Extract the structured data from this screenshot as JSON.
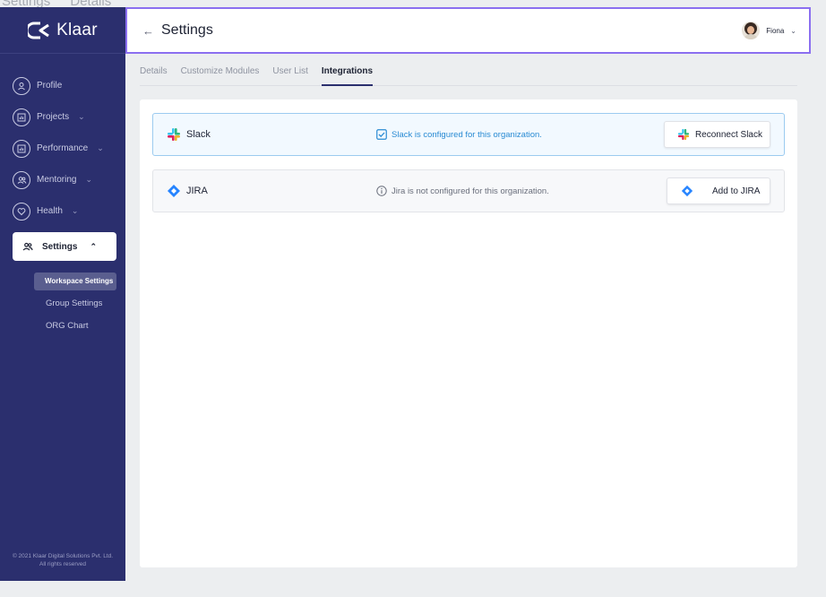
{
  "frame": {
    "crumbs": [
      "Settings",
      "Details"
    ]
  },
  "sidebar": {
    "logo_text": "Klaar",
    "items": [
      {
        "label": "Profile",
        "icon": "user-icon",
        "has_chevron": false
      },
      {
        "label": "Projects",
        "icon": "chart-icon",
        "has_chevron": true
      },
      {
        "label": "Performance",
        "icon": "chart-icon",
        "has_chevron": true
      },
      {
        "label": "Mentoring",
        "icon": "people-icon",
        "has_chevron": true
      },
      {
        "label": "Health",
        "icon": "heart-icon",
        "has_chevron": true
      }
    ],
    "active_item": {
      "label": "Settings",
      "icon": "people-icon"
    },
    "subitems": [
      "Workspace Settings",
      "Group Settings",
      "ORG Chart"
    ],
    "active_subitem": "Workspace Settings",
    "copyright_line1": "© 2021 Klaar Digital Solutions Pvt. Ltd.",
    "copyright_line2": "All rights reserved"
  },
  "header": {
    "title": "Settings",
    "user_name": "Fiona"
  },
  "tabs": [
    {
      "label": "Details",
      "active": false
    },
    {
      "label": "Customize Modules",
      "active": false
    },
    {
      "label": "User List",
      "active": false
    },
    {
      "label": "Integrations",
      "active": true
    }
  ],
  "integrations": [
    {
      "name": "Slack",
      "status": "Slack is configured for this organization.",
      "status_kind": "configured",
      "button": "Reconnect Slack"
    },
    {
      "name": "JIRA",
      "status": "Jira is not configured for this organization.",
      "status_kind": "not-configured",
      "button": "Add to JIRA"
    }
  ],
  "colors": {
    "sidebar_bg": "#2b2f6e",
    "accent_outline": "#8b6ff0",
    "configured_blue": "#2a8bd3",
    "jira_blue": "#2684ff"
  }
}
